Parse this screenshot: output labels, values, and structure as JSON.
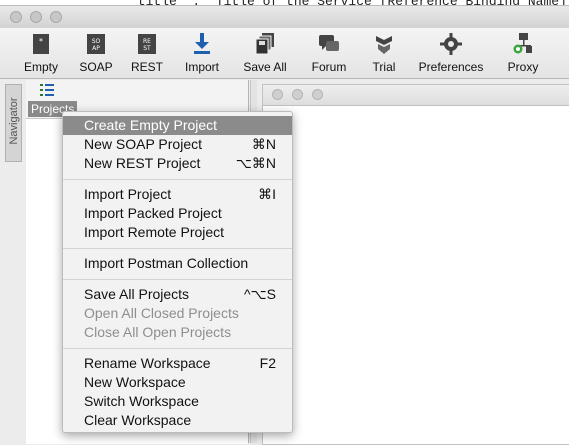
{
  "background": {
    "code_snippet": "\"title\" : \"Title of the Service [Reference Binding Name]\""
  },
  "toolbar": {
    "items": [
      {
        "label": "Empty",
        "icon": "new-file-icon"
      },
      {
        "label": "SOAP",
        "icon": "soap-icon"
      },
      {
        "label": "REST",
        "icon": "rest-icon"
      },
      {
        "label": "Import",
        "icon": "import-icon"
      },
      {
        "label": "Save All",
        "icon": "save-all-icon"
      },
      {
        "label": "Forum",
        "icon": "forum-icon"
      },
      {
        "label": "Trial",
        "icon": "trial-icon"
      },
      {
        "label": "Preferences",
        "icon": "gear-icon"
      },
      {
        "label": "Proxy",
        "icon": "proxy-icon"
      }
    ]
  },
  "navigator": {
    "tab_label": "Navigator",
    "projects_label": "Projects"
  },
  "context_menu": {
    "items": [
      {
        "label": "Create Empty Project",
        "shortcut": "",
        "state": "selected"
      },
      {
        "label": "New SOAP Project",
        "shortcut": "⌘N",
        "state": "enabled"
      },
      {
        "label": "New REST Project",
        "shortcut": "⌥⌘N",
        "state": "enabled"
      },
      {
        "label": "Import Project",
        "shortcut": "⌘I",
        "state": "enabled"
      },
      {
        "label": "Import Packed Project",
        "shortcut": "",
        "state": "enabled"
      },
      {
        "label": "Import Remote Project",
        "shortcut": "",
        "state": "enabled"
      },
      {
        "label": "Import Postman Collection",
        "shortcut": "",
        "state": "enabled"
      },
      {
        "label": "Save All Projects",
        "shortcut": "^⌥S",
        "state": "enabled"
      },
      {
        "label": "Open All Closed Projects",
        "shortcut": "",
        "state": "disabled"
      },
      {
        "label": "Close All Open Projects",
        "shortcut": "",
        "state": "disabled"
      },
      {
        "label": "Rename Workspace",
        "shortcut": "F2",
        "state": "enabled"
      },
      {
        "label": "New Workspace",
        "shortcut": "",
        "state": "enabled"
      },
      {
        "label": "Switch Workspace",
        "shortcut": "",
        "state": "enabled"
      },
      {
        "label": "Clear Workspace",
        "shortcut": "",
        "state": "enabled"
      }
    ]
  },
  "colors": {
    "selection": "#8b8b8b",
    "accent_blue": "#1f5fb0",
    "proxy_green": "#3aa53a"
  }
}
